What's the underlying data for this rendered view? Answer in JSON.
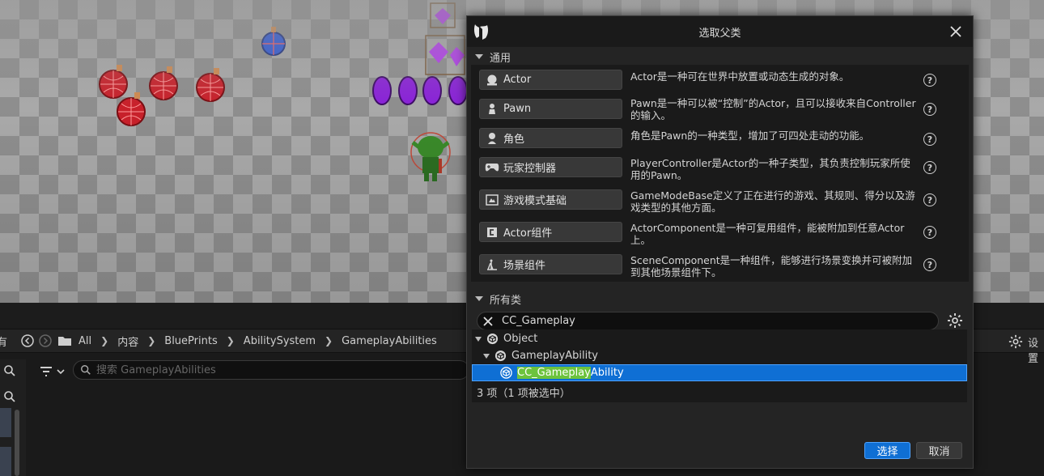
{
  "dialog": {
    "title": "选取父类",
    "common_section": "通用",
    "all_section": "所有类",
    "common_classes": [
      {
        "label": "Actor",
        "icon": "actor-icon",
        "desc": "Actor是一种可在世界中放置或动态生成的对象。"
      },
      {
        "label": "Pawn",
        "icon": "pawn-icon",
        "desc": "Pawn是一种可以被“控制”的Actor，且可以接收来自Controller的输入。"
      },
      {
        "label": "角色",
        "icon": "character-icon",
        "desc": "角色是Pawn的一种类型，增加了可四处走动的功能。"
      },
      {
        "label": "玩家控制器",
        "icon": "gamepad-icon",
        "desc": "PlayerController是Actor的一种子类型，其负责控制玩家所使用的Pawn。"
      },
      {
        "label": "游戏模式基础",
        "icon": "game-mode-icon",
        "desc": "GameModeBase定义了正在进行的游戏、其规则、得分以及游戏类型的其他方面。"
      },
      {
        "label": "Actor组件",
        "icon": "actor-component-icon",
        "desc": "ActorComponent是一种可复用组件，能被附加到任意Actor上。"
      },
      {
        "label": "场景组件",
        "icon": "scene-component-icon",
        "desc": "SceneComponent是一种组件，能够进行场景变换并可被附加到其他场景组件下。"
      }
    ],
    "search_value": "CC_Gameplay",
    "tree": {
      "object": "Object",
      "gameplay_ability": "GameplayAbility",
      "selected_highlight": "CC_Gameplay",
      "selected_rest": "Ability"
    },
    "count_text": "3 项（1 项被选中）",
    "select_label": "选择",
    "cancel_label": "取消"
  },
  "content_browser": {
    "left_cut_label": "有",
    "breadcrumbs": [
      "All",
      "内容",
      "BluePrints",
      "AbilitySystem",
      "GameplayAbilities"
    ],
    "search_placeholder": "搜索 GameplayAbilities",
    "settings_label": "设置"
  },
  "colors": {
    "accent": "#0f6fd4",
    "highlight": "#6cc33d",
    "panel": "#242424"
  }
}
